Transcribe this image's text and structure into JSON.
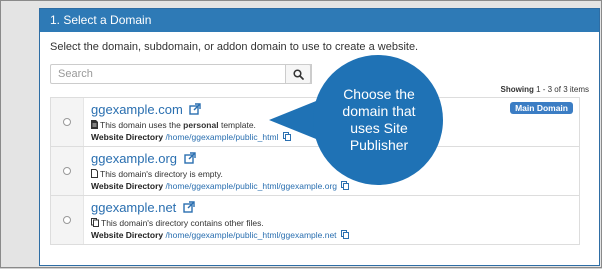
{
  "section": {
    "title": "1. Select a Domain",
    "intro": "Select the domain, subdomain, or addon domain to use to create a website."
  },
  "search": {
    "placeholder": "Search"
  },
  "showing": {
    "label": "Showing",
    "range": "1 - 3 of 3 items"
  },
  "domains": [
    {
      "name": "ggexample.com",
      "note_prefix": "This domain uses the ",
      "note_bold": "personal",
      "note_suffix": " template.",
      "dir_label": "Website Directory",
      "dir_path": "/home/ggexample/public_html",
      "badge": "Main Domain",
      "icon": "file-icon"
    },
    {
      "name": "ggexample.org",
      "note": "This domain's directory is empty.",
      "dir_label": "Website Directory",
      "dir_path": "/home/ggexample/public_html/ggexample.org",
      "icon": "empty-file-icon"
    },
    {
      "name": "ggexample.net",
      "note": "This domain's directory contains other files.",
      "dir_label": "Website Directory",
      "dir_path": "/home/ggexample/public_html/ggexample.net",
      "icon": "files-icon"
    }
  ],
  "callout": {
    "text_lines": [
      "Choose the",
      "domain that",
      "uses Site",
      "Publisher"
    ],
    "color": "#1f72b5"
  },
  "colors": {
    "header": "#2e7ab6",
    "link": "#2a6fb0",
    "badge": "#3b7dc4"
  }
}
